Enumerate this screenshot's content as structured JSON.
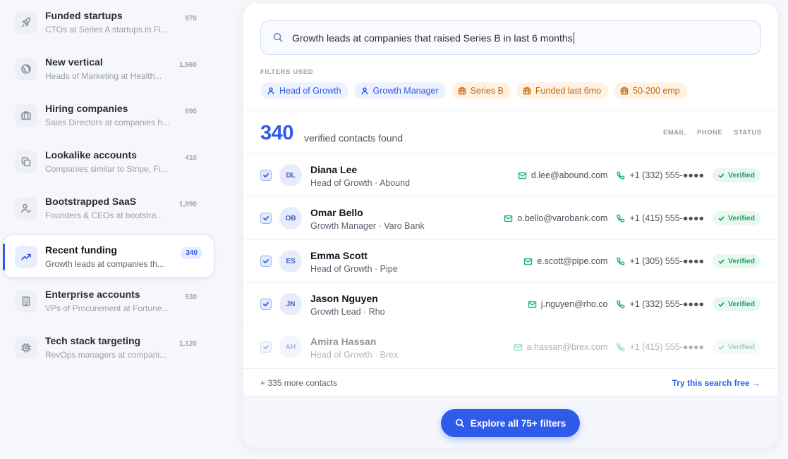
{
  "sidebar": {
    "items": [
      {
        "title": "Funded startups",
        "subtitle": "CTOs at Series A startups in Fin...",
        "count": "870",
        "icon": "rocket-icon"
      },
      {
        "title": "New vertical",
        "subtitle": "Heads of Marketing at Health...",
        "count": "1,560",
        "icon": "globe-icon"
      },
      {
        "title": "Hiring companies",
        "subtitle": "Sales Directors at companies h...",
        "count": "690",
        "icon": "briefcase-icon"
      },
      {
        "title": "Lookalike accounts",
        "subtitle": "Companies similar to Stripe, Fi...",
        "count": "410",
        "icon": "copy-icon"
      },
      {
        "title": "Bootstrapped SaaS",
        "subtitle": "Founders & CEOs at bootstra...",
        "count": "1,890",
        "icon": "user-check-icon"
      },
      {
        "title": "Recent funding",
        "subtitle": "Growth leads at companies th...",
        "count": "340",
        "icon": "trending-up-icon",
        "active": true
      },
      {
        "title": "Enterprise accounts",
        "subtitle": "VPs of Procurement at Fortune...",
        "count": "530",
        "icon": "building-icon"
      },
      {
        "title": "Tech stack targeting",
        "subtitle": "RevOps managers at compani...",
        "count": "1,120",
        "icon": "cpu-icon"
      }
    ]
  },
  "search": {
    "query": "Growth leads at companies that raised Series B in last 6 months"
  },
  "filters": {
    "label": "FILTERS USED",
    "chips": [
      {
        "label": "Head of Growth",
        "kind": "person"
      },
      {
        "label": "Growth Manager",
        "kind": "person"
      },
      {
        "label": "Series B",
        "kind": "company"
      },
      {
        "label": "Funded last 6mo",
        "kind": "company"
      },
      {
        "label": "50-200 emp",
        "kind": "company"
      }
    ]
  },
  "results": {
    "count": "340",
    "count_label": "verified contacts found",
    "columns": {
      "email": "EMAIL",
      "phone": "PHONE",
      "status": "STATUS"
    },
    "rows": [
      {
        "initials": "DL",
        "name": "Diana Lee",
        "role": "Head of Growth · Abound",
        "email": "d.lee@abound.com",
        "phone": "+1 (332) 555-●●●●",
        "status": "Verified"
      },
      {
        "initials": "OB",
        "name": "Omar Bello",
        "role": "Growth Manager · Varo Bank",
        "email": "o.bello@varobank.com",
        "phone": "+1 (415) 555-●●●●",
        "status": "Verified"
      },
      {
        "initials": "ES",
        "name": "Emma Scott",
        "role": "Head of Growth · Pipe",
        "email": "e.scott@pipe.com",
        "phone": "+1 (305) 555-●●●●",
        "status": "Verified"
      },
      {
        "initials": "JN",
        "name": "Jason Nguyen",
        "role": "Growth Lead · Rho",
        "email": "j.nguyen@rho.co",
        "phone": "+1 (332) 555-●●●●",
        "status": "Verified"
      },
      {
        "initials": "AH",
        "name": "Amira Hassan",
        "role": "Head of Growth · Brex",
        "email": "a.hassan@brex.com",
        "phone": "+1 (415) 555-●●●●",
        "status": "Verified"
      }
    ],
    "more_label": "+ 335 more contacts",
    "try_label": "Try this search free →"
  },
  "cta": {
    "label": "Explore all 75+ filters"
  },
  "colors": {
    "accent": "#2f5bea",
    "verified": "#1e9e6a",
    "company_chip": "#c2660f"
  }
}
